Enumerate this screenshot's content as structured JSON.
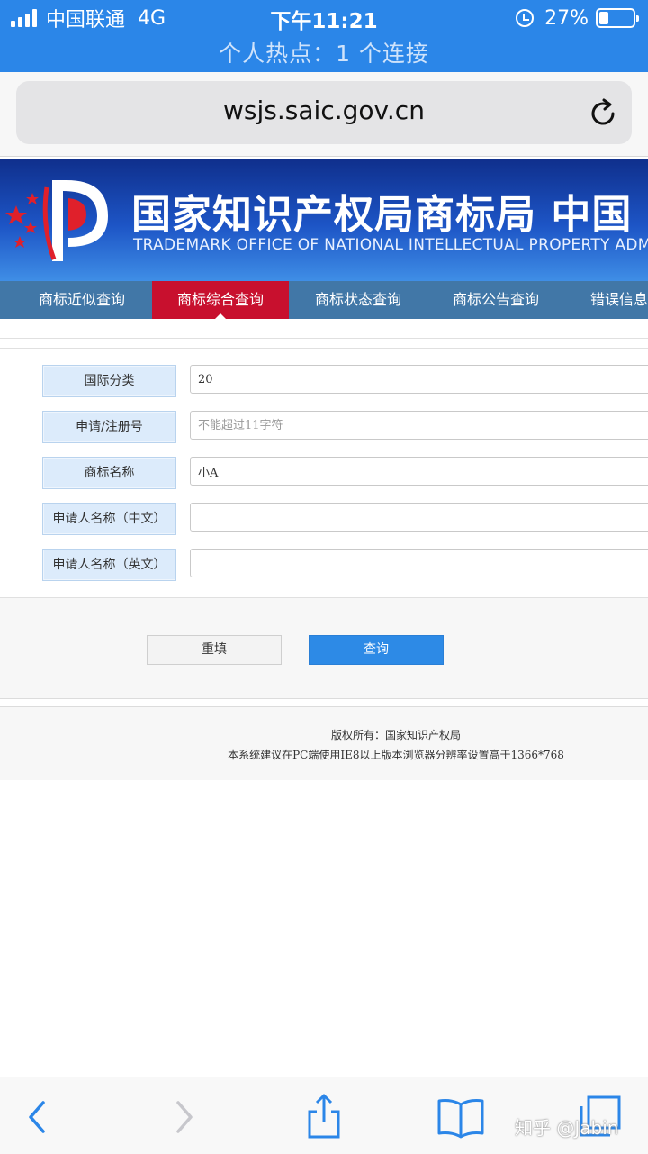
{
  "status_bar": {
    "carrier": "中国联通",
    "network": "4G",
    "time": "下午11:21",
    "battery": "27%",
    "battery_level": 0.27,
    "hotspot": "个人热点：1 个连接"
  },
  "browser": {
    "url": "wsjs.saic.gov.cn"
  },
  "banner": {
    "title_cn": "国家知识产权局商标局 中国",
    "title_en": "TRADEMARK OFFICE OF NATIONAL INTELLECTUAL PROPERTY ADMI"
  },
  "nav": {
    "items": [
      {
        "label": "商标近似查询"
      },
      {
        "label": "商标综合查询"
      },
      {
        "label": "商标状态查询"
      },
      {
        "label": "商标公告查询"
      },
      {
        "label": "错误信息"
      }
    ],
    "active_index": 1
  },
  "form": {
    "fields": [
      {
        "label": "国际分类",
        "value": "20",
        "placeholder": ""
      },
      {
        "label": "申请/注册号",
        "value": "",
        "placeholder": "不能超过11字符"
      },
      {
        "label": "商标名称",
        "value": "小A",
        "placeholder": ""
      },
      {
        "label": "申请人名称（中文）",
        "value": "",
        "placeholder": ""
      },
      {
        "label": "申请人名称（英文）",
        "value": "",
        "placeholder": ""
      }
    ],
    "reset_label": "重填",
    "query_label": "查询"
  },
  "footer": {
    "copyright": "版权所有：国家知识产权局",
    "note": "本系统建议在PC端使用IE8以上版本浏览器分辨率设置高于1366*768"
  },
  "watermark": "知乎 @Jabin",
  "colors": {
    "accent": "#2b86e8",
    "nav": "#4177a7",
    "nav_active": "#c8102e",
    "label_bg": "#dcebfb",
    "query_button": "#2d8ae6"
  }
}
